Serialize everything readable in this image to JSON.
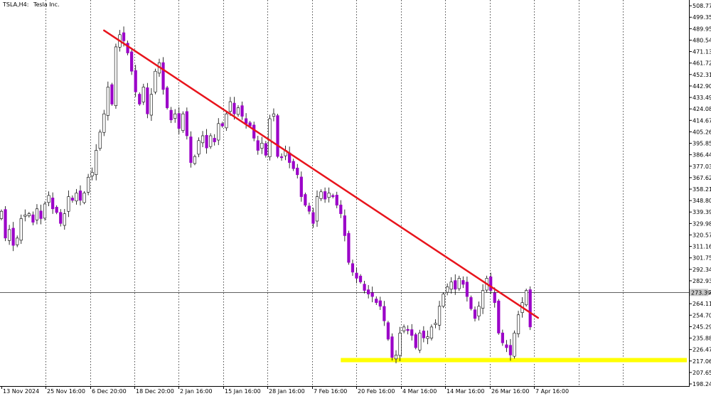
{
  "header": {
    "symbol": "TSLA,H4:",
    "name": "Tesla Inc."
  },
  "colors": {
    "bull_body": "#ffffff",
    "bear_body": "#9b00c8",
    "wick": "#000000",
    "trendline": "#e8141c",
    "support": "#ffff00",
    "grid": "#000000",
    "price_tag_bg": "#c8c8c8"
  },
  "chart_data": {
    "type": "candlestick",
    "title": "",
    "price_axis": [
      "508.77",
      "499.35",
      "489.95",
      "480.54",
      "471.13",
      "461.72",
      "452.31",
      "442.90",
      "433.49",
      "424.08",
      "414.67",
      "405.26",
      "395.85",
      "386.44",
      "377.03",
      "367.62",
      "358.21",
      "348.80",
      "339.39",
      "329.98",
      "320.57",
      "311.16",
      "301.75",
      "292.34",
      "282.93",
      "273.52",
      "264.11",
      "254.70",
      "245.29",
      "235.88",
      "226.47",
      "217.06",
      "207.65",
      "198.24"
    ],
    "ylim": [
      196.5,
      513.5
    ],
    "time_axis": [
      "13 Nov 2024",
      "25 Nov 16:00",
      "6 Dec 20:00",
      "18 Dec 20:00",
      "2 Jan 16:00",
      "15 Jan 16:00",
      "28 Jan 16:00",
      "7 Feb 16:00",
      "20 Feb 16:00",
      "4 Mar 16:00",
      "14 Mar 16:00",
      "26 Mar 16:00",
      "7 Apr 16:00"
    ],
    "time_gridlines": true,
    "current_price": "273.39",
    "trendline": {
      "from": {
        "bar": 26,
        "price": 488.5
      },
      "to": {
        "bar": 136,
        "price": 252.5
      }
    },
    "support_zone": {
      "price": 217.8,
      "from_bar": 86,
      "to_bar": 139
    },
    "closes": [
      340,
      318,
      325,
      312,
      318,
      334,
      337,
      338,
      331,
      342,
      334,
      346,
      353,
      342,
      339,
      330,
      338,
      352,
      349,
      355,
      349,
      355,
      368,
      372,
      390,
      405,
      420,
      442,
      428,
      475,
      485,
      480,
      470,
      455,
      438,
      428,
      442,
      420,
      436,
      455,
      462,
      440,
      425,
      415,
      420,
      408,
      420,
      402,
      380,
      385,
      398,
      402,
      392,
      402,
      397,
      412,
      410,
      420,
      430,
      420,
      425,
      418,
      412,
      410,
      400,
      390,
      396,
      386,
      416,
      420,
      385,
      384,
      390,
      380,
      375,
      370,
      352,
      345,
      340,
      330,
      352,
      356,
      350,
      355,
      352,
      345,
      338,
      320,
      298,
      290,
      285,
      282,
      275,
      272,
      270,
      265,
      262,
      250,
      235,
      220,
      222,
      240,
      245,
      242,
      238,
      228,
      240,
      236,
      237,
      245,
      248,
      262,
      272,
      278,
      282,
      276,
      285,
      280,
      270,
      260,
      252,
      262,
      275,
      285,
      275,
      265,
      240,
      232,
      228,
      222,
      240,
      255,
      265,
      275,
      245
    ]
  }
}
